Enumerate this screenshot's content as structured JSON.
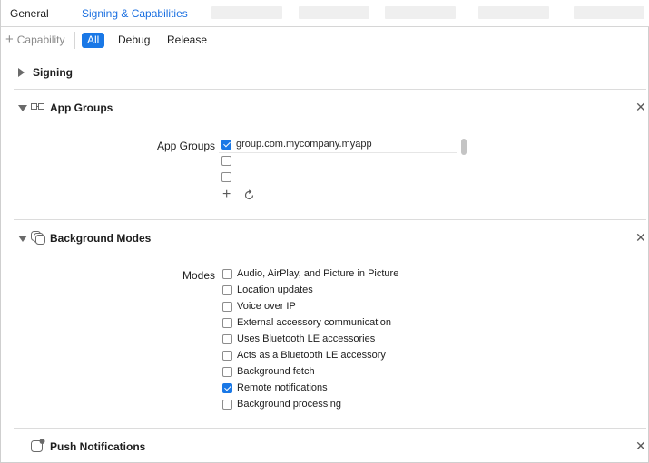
{
  "tabs": {
    "general": "General",
    "signing": "Signing & Capabilities"
  },
  "filter": {
    "add_capability": "Capability",
    "all": "All",
    "debug": "Debug",
    "release": "Release"
  },
  "signing": {
    "title": "Signing"
  },
  "app_groups": {
    "title": "App Groups",
    "field_label": "App Groups",
    "items": [
      {
        "label": "group.com.mycompany.myapp",
        "checked": true
      },
      {
        "label": "",
        "checked": false
      },
      {
        "label": "",
        "checked": false
      }
    ]
  },
  "background_modes": {
    "title": "Background Modes",
    "field_label": "Modes",
    "modes": [
      {
        "label": "Audio, AirPlay, and Picture in Picture",
        "checked": false
      },
      {
        "label": "Location updates",
        "checked": false
      },
      {
        "label": "Voice over IP",
        "checked": false
      },
      {
        "label": "External accessory communication",
        "checked": false
      },
      {
        "label": "Uses Bluetooth LE accessories",
        "checked": false
      },
      {
        "label": "Acts as a Bluetooth LE accessory",
        "checked": false
      },
      {
        "label": "Background fetch",
        "checked": false
      },
      {
        "label": "Remote notifications",
        "checked": true
      },
      {
        "label": "Background processing",
        "checked": false
      }
    ]
  },
  "push_notifications": {
    "title": "Push Notifications"
  },
  "colors": {
    "accent": "#1a78e6",
    "link": "#1a6fe0"
  },
  "icons": {
    "close": "close-icon",
    "disclosure": "disclosure-triangle-icon",
    "app_groups": "app-groups-icon",
    "background_modes": "background-modes-icon",
    "push_notifications": "push-notifications-icon",
    "add": "plus-icon",
    "refresh": "refresh-icon"
  }
}
